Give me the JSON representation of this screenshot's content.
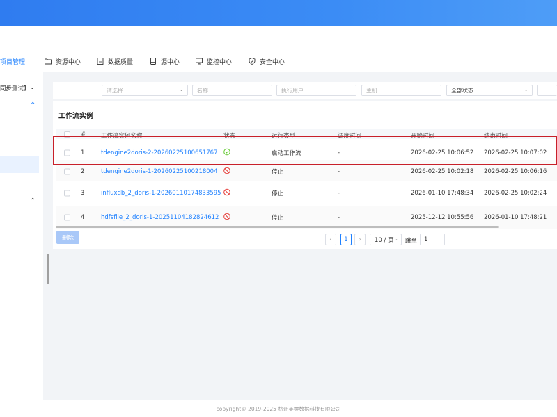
{
  "nav": {
    "items": [
      {
        "label": "项目管理",
        "icon": "project-icon",
        "active": true
      },
      {
        "label": "资源中心",
        "icon": "folder-icon"
      },
      {
        "label": "数据质量",
        "icon": "data-quality-icon"
      },
      {
        "label": "源中心",
        "icon": "database-icon"
      },
      {
        "label": "监控中心",
        "icon": "monitor-icon"
      },
      {
        "label": "安全中心",
        "icon": "shield-icon"
      }
    ]
  },
  "sidebar": {
    "project_select": "同步测试】"
  },
  "filters": {
    "select_placeholder": "请选择",
    "name_placeholder": "名称",
    "user_placeholder": "执行用户",
    "host_placeholder": "主机",
    "status_value": "全部状态"
  },
  "card": {
    "title": "工作流实例"
  },
  "table": {
    "headers": {
      "index": "#",
      "name": "工作流实例名称",
      "status": "状态",
      "run_type": "运行类型",
      "schedule_time": "调度时间",
      "start_time": "开始时间",
      "end_time": "结束时间"
    },
    "rows": [
      {
        "index": "1",
        "name": "tdengine2doris-2-20260225100651767",
        "status": "success",
        "run_type": "启动工作流",
        "schedule_time": "-",
        "start_time": "2026-02-25 10:06:52",
        "end_time": "2026-02-25 10:07:02"
      },
      {
        "index": "2",
        "name": "tdengine2doris-1-20260225100218004",
        "status": "stopped",
        "run_type": "停止",
        "schedule_time": "-",
        "start_time": "2026-02-25 10:02:18",
        "end_time": "2026-02-25 10:06:16"
      },
      {
        "index": "3",
        "name": "influxdb_2_doris-1-20260110174833595",
        "status": "stopped",
        "run_type": "停止",
        "schedule_time": "-",
        "start_time": "2026-01-10 17:48:34",
        "end_time": "2026-02-25 10:02:24"
      },
      {
        "index": "4",
        "name": "hdfsfile_2_doris-1-20251104182824612",
        "status": "stopped",
        "run_type": "停止",
        "schedule_time": "-",
        "start_time": "2025-12-12 10:55:56",
        "end_time": "2026-01-10 17:48:21"
      }
    ]
  },
  "actions": {
    "delete_label": "删除"
  },
  "pagination": {
    "current_page": "1",
    "page_size": "10 / 页",
    "jump_label": "跳至",
    "jump_value": "1"
  },
  "footer": {
    "copyright": "copyright© 2019-2025 杭州美零数据科技有限公司"
  },
  "colors": {
    "accent": "#1e80ff",
    "header_blue": "#3b8cf5",
    "success": "#52c41a",
    "stop": "#e53935",
    "highlight": "#c8202a"
  }
}
